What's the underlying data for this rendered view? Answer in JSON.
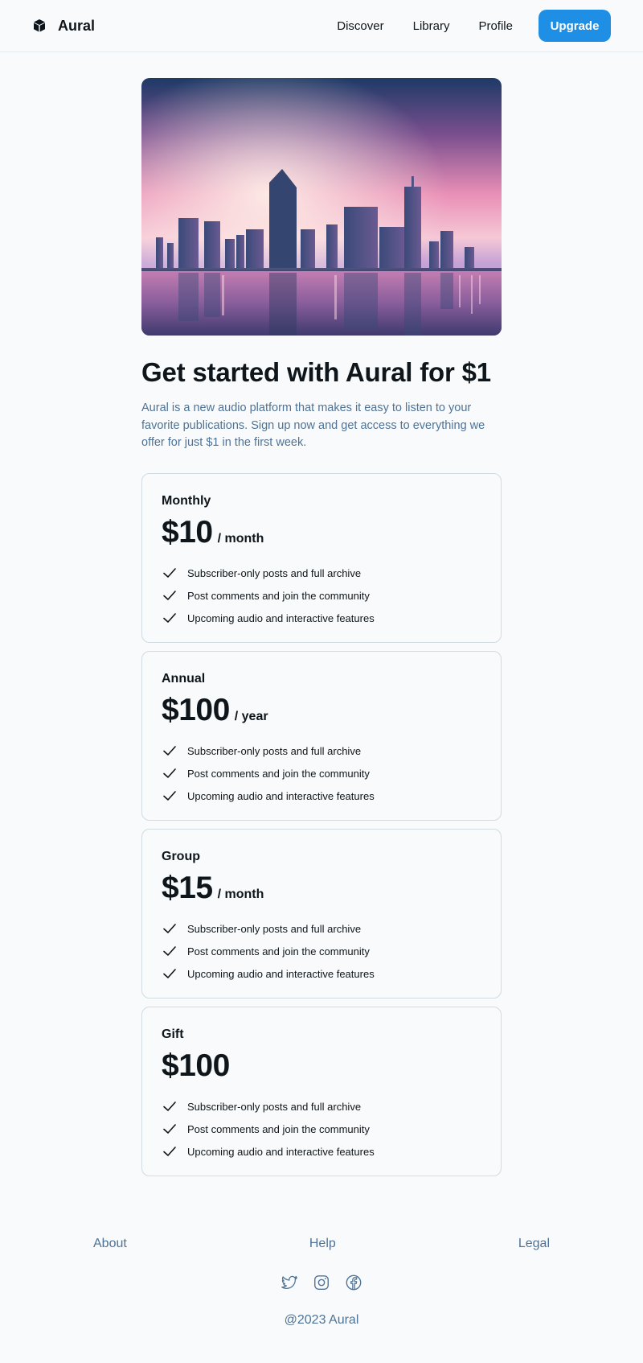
{
  "header": {
    "brand_icon": "cube-icon",
    "brand_name": "Aural",
    "nav": [
      "Discover",
      "Library",
      "Profile"
    ],
    "upgrade_label": "Upgrade"
  },
  "hero": {
    "image_subject": "city skyline at dusk reflected in water"
  },
  "main": {
    "title": "Get started with Aural for $1",
    "intro": "Aural is a new audio platform that makes it easy to listen to your favorite publications. Sign up now and get access to everything we offer for just $1 in the first week."
  },
  "plans": [
    {
      "name": "Monthly",
      "price": "$10",
      "period": "/ month",
      "features": [
        "Subscriber-only posts and full archive",
        "Post comments and join the community",
        "Upcoming audio and interactive features"
      ]
    },
    {
      "name": "Annual",
      "price": "$100",
      "period": "/ year",
      "features": [
        "Subscriber-only posts and full archive",
        "Post comments and join the community",
        "Upcoming audio and interactive features"
      ]
    },
    {
      "name": "Group",
      "price": "$15",
      "period": "/ month",
      "features": [
        "Subscriber-only posts and full archive",
        "Post comments and join the community",
        "Upcoming audio and interactive features"
      ]
    },
    {
      "name": "Gift",
      "price": "$100",
      "period": "",
      "features": [
        "Subscriber-only posts and full archive",
        "Post comments and join the community",
        "Upcoming audio and interactive features"
      ]
    }
  ],
  "footer": {
    "links": [
      "About",
      "Help",
      "Legal"
    ],
    "socials": [
      "twitter-icon",
      "instagram-icon",
      "facebook-icon"
    ],
    "copyright": "@2023 Aural"
  },
  "colors": {
    "accent": "#1f8fe6",
    "muted_text": "#4e7397",
    "border": "#d0dbe2",
    "background": "#f8fafb"
  }
}
